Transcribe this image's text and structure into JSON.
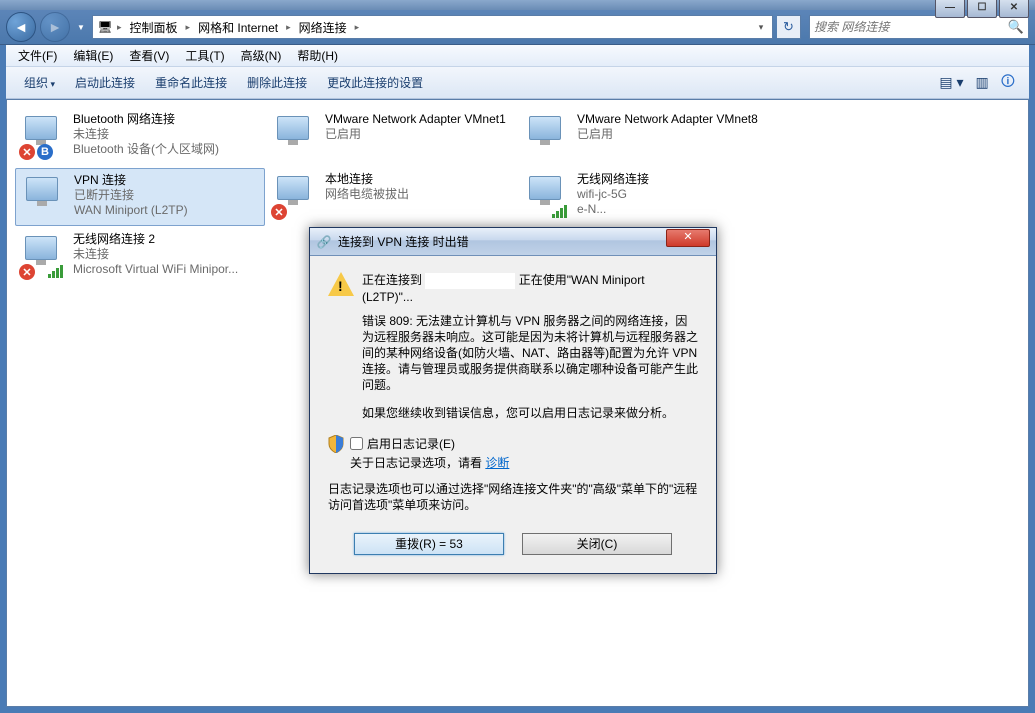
{
  "breadcrumb": {
    "root": "控制面板",
    "mid": "网格和 Internet",
    "leaf": "网络连接"
  },
  "search": {
    "placeholder": "搜索 网络连接"
  },
  "menubar": {
    "file": "文件(F)",
    "edit": "编辑(E)",
    "view": "查看(V)",
    "tools": "工具(T)",
    "advanced": "高级(N)",
    "help": "帮助(H)"
  },
  "toolbar": {
    "organize": "组织",
    "start": "启动此连接",
    "rename": "重命名此连接",
    "delete": "删除此连接",
    "change": "更改此连接的设置"
  },
  "connections": [
    {
      "name": "Bluetooth 网络连接",
      "status": "未连接",
      "device": "Bluetooth 设备(个人区域网)",
      "badge": "red",
      "selected": false
    },
    {
      "name": "VMware Network Adapter VMnet1",
      "status": "已启用",
      "device": "",
      "badge": "",
      "selected": false
    },
    {
      "name": "VMware Network Adapter VMnet8",
      "status": "已启用",
      "device": "",
      "badge": "",
      "selected": false
    },
    {
      "name": "VPN 连接",
      "status": "已断开连接",
      "device": "WAN Miniport (L2TP)",
      "badge": "",
      "selected": true
    },
    {
      "name": "本地连接",
      "status": "网络电缆被拔出",
      "device": "",
      "badge": "red",
      "selected": false
    },
    {
      "name": "无线网络连接",
      "status": "wifi-jc-5G",
      "device": "e-N...",
      "badge": "wifi",
      "selected": false
    },
    {
      "name": "无线网络连接 2",
      "status": "未连接",
      "device": "Microsoft Virtual WiFi Minipor...",
      "badge": "redwifi",
      "selected": false
    }
  ],
  "dialog": {
    "title": "连接到 VPN 连接 时出错",
    "connecting_pre": "正在连接到",
    "connecting_post": "正在使用\"WAN Miniport (L2TP)\"...",
    "error": "错误 809: 无法建立计算机与 VPN 服务器之间的网络连接，因为远程服务器未响应。这可能是因为未将计算机与远程服务器之间的某种网络设备(如防火墙、NAT、路由器等)配置为允许 VPN 连接。请与管理员或服务提供商联系以确定哪种设备可能产生此问题。",
    "hint": "如果您继续收到错误信息，您可以启用日志记录来做分析。",
    "enable_log": "启用日志记录(E)",
    "about_log_pre": "关于日志记录选项，请看 ",
    "about_log_link": "诊断",
    "note": "日志记录选项也可以通过选择\"网络连接文件夹\"的\"高级\"菜单下的\"远程访问首选项\"菜单项来访问。",
    "redial": "重拨(R) = 53",
    "close": "关闭(C)"
  }
}
